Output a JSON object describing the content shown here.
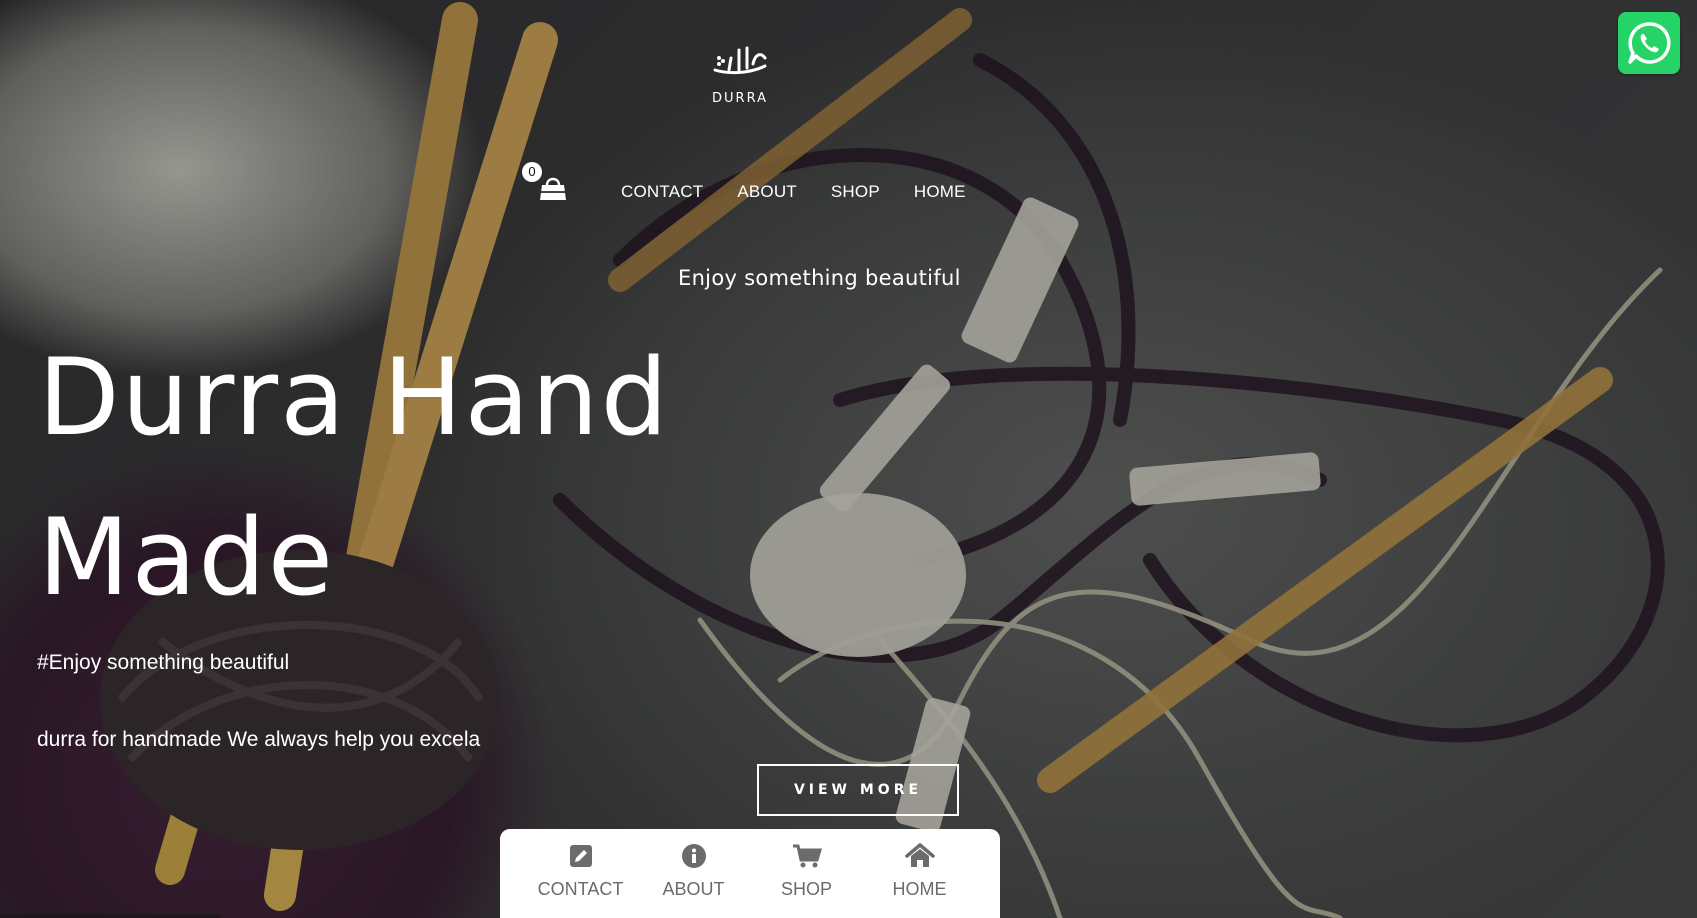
{
  "header": {
    "logo_text": "DURRA",
    "cart_count": "0",
    "nav": [
      {
        "label": "CONTACT"
      },
      {
        "label": "ABOUT"
      },
      {
        "label": "SHOP"
      },
      {
        "label": "HOME"
      }
    ]
  },
  "hero": {
    "tagline": "Enjoy something beautiful",
    "title_line1": "Durra Hand",
    "title_line2": "Made",
    "hashtag": "#Enjoy something beautiful",
    "description": "durra for handmade We always help you excela",
    "button_label": "VIEW MORE"
  },
  "bottom_bar": {
    "tabs": [
      {
        "label": "CONTACT",
        "icon": "edit-icon"
      },
      {
        "label": "ABOUT",
        "icon": "info-icon"
      },
      {
        "label": "SHOP",
        "icon": "cart-icon"
      },
      {
        "label": "HOME",
        "icon": "home-icon"
      }
    ]
  },
  "colors": {
    "whatsapp": "#25d366",
    "text": "#ffffff",
    "tab_text": "#6b6b6b"
  }
}
